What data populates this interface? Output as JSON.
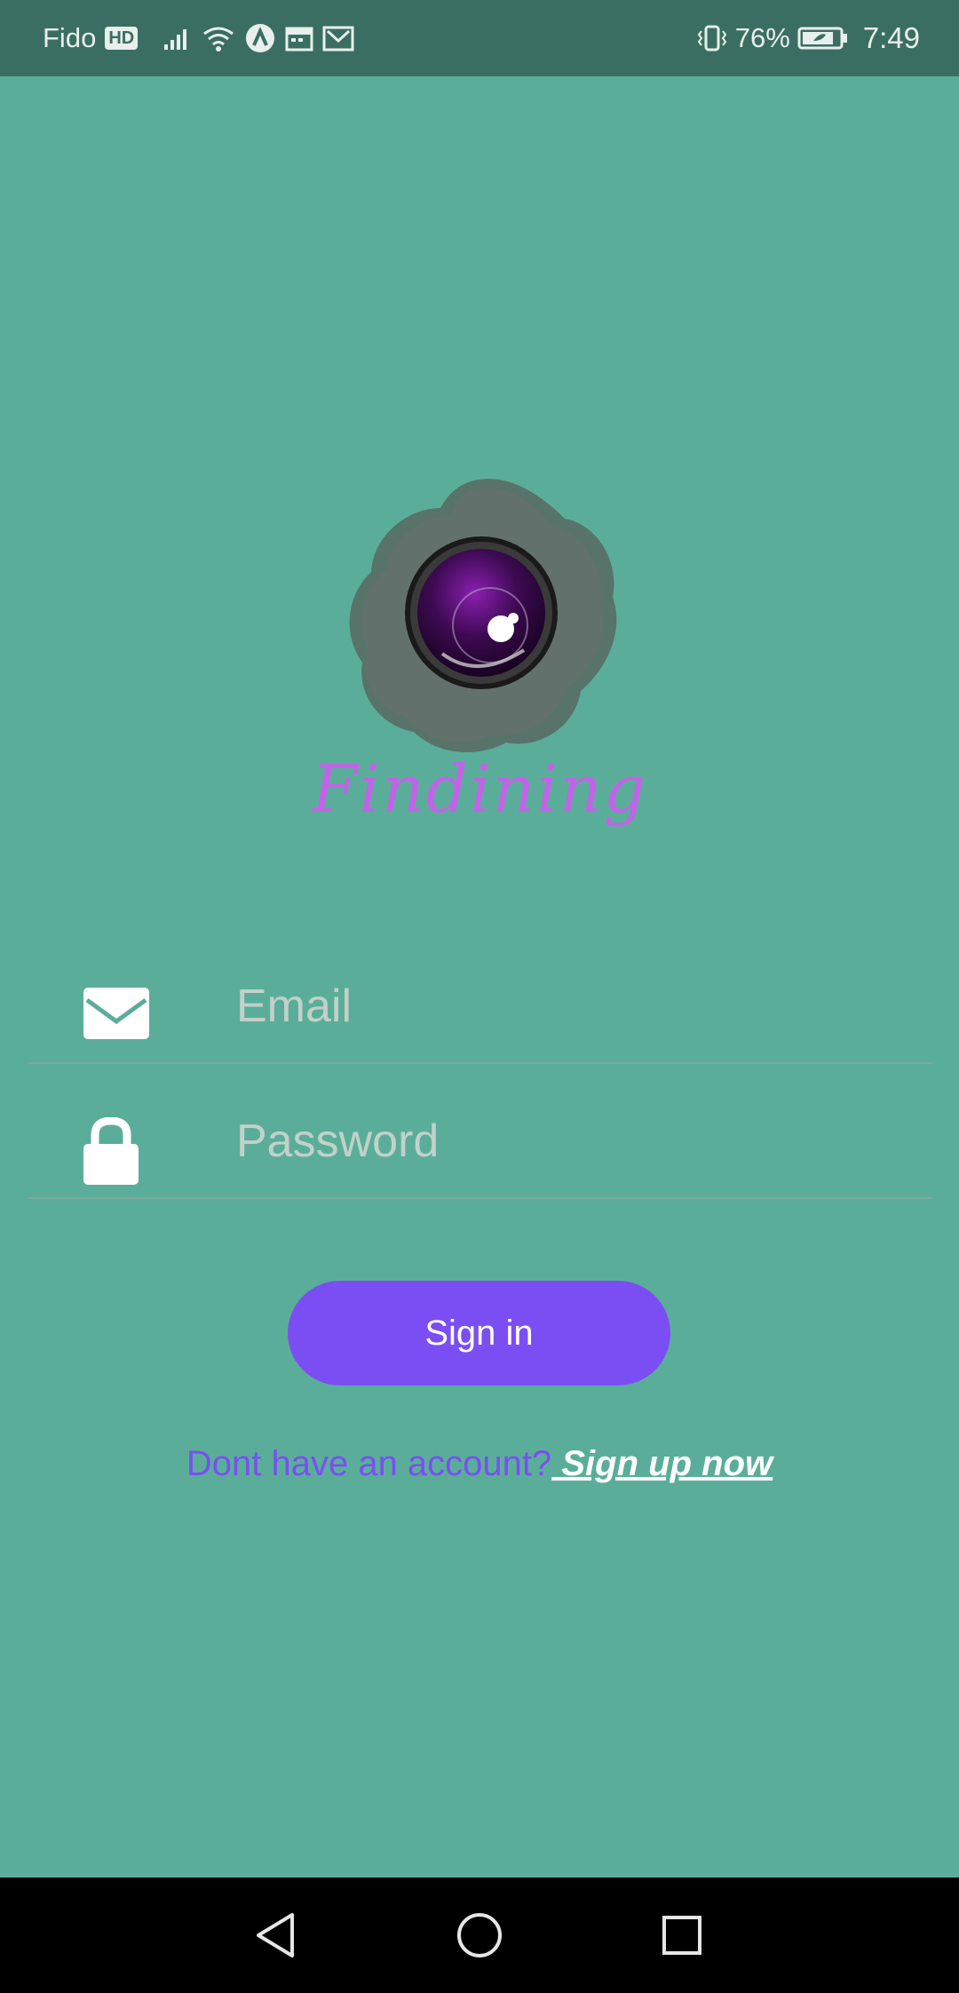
{
  "status_bar": {
    "carrier": "Fido",
    "hd_badge": "HD",
    "battery_percent": "76%",
    "time": "7:49",
    "icons": [
      "signal-icon",
      "wifi-icon",
      "app-notification-icon",
      "calendar-icon",
      "mail-icon",
      "vibrate-icon",
      "battery-icon"
    ]
  },
  "logo": {
    "icon": "camera-lens-logo",
    "app_name": "Findining"
  },
  "form": {
    "email": {
      "icon": "envelope-icon",
      "placeholder": "Email",
      "value": ""
    },
    "password": {
      "icon": "lock-icon",
      "placeholder": "Password",
      "value": ""
    },
    "sign_in_label": "Sign in",
    "signup_prompt": "Dont have an account?",
    "signup_link": " Sign up now "
  },
  "nav_bar": {
    "buttons": [
      "back-icon",
      "home-icon",
      "recents-icon"
    ]
  },
  "colors": {
    "background": "#5aae99",
    "status_bar": "#3b6e62",
    "accent": "#7b4ef3",
    "app_name": "#c264e8"
  }
}
